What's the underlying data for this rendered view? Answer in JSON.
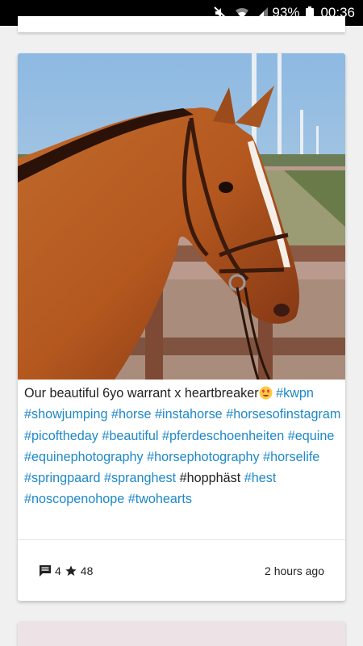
{
  "status_bar": {
    "battery": "93%",
    "time": "00:36",
    "icons": [
      "mute-icon",
      "wifi-icon",
      "signal-icon",
      "battery-icon"
    ]
  },
  "post": {
    "caption_text": "Our beautiful 6yo warrant x heartbreaker",
    "caption_emoji": "heart-eyes-emoji",
    "hashtags": [
      "#kwpn",
      "#showjumping",
      "#horse",
      "#instahorse",
      "#horsesofinstagram",
      "#picoftheday",
      "#beautiful",
      "#pferdeschoenheiten",
      "#equine",
      "#equinephotography",
      "#horsephotography",
      "#horselife",
      "#springpaard",
      "#spranghest",
      "#hopphäst",
      "#hest",
      "#noscopenohope",
      "#twohearts"
    ],
    "comments_count": "4",
    "likes_count": "48",
    "timestamp": "2 hours ago"
  },
  "colors": {
    "hashtag": "#1e88c8",
    "status_bar_bg": "#000000",
    "next_card_bg": "#ede3e6"
  }
}
